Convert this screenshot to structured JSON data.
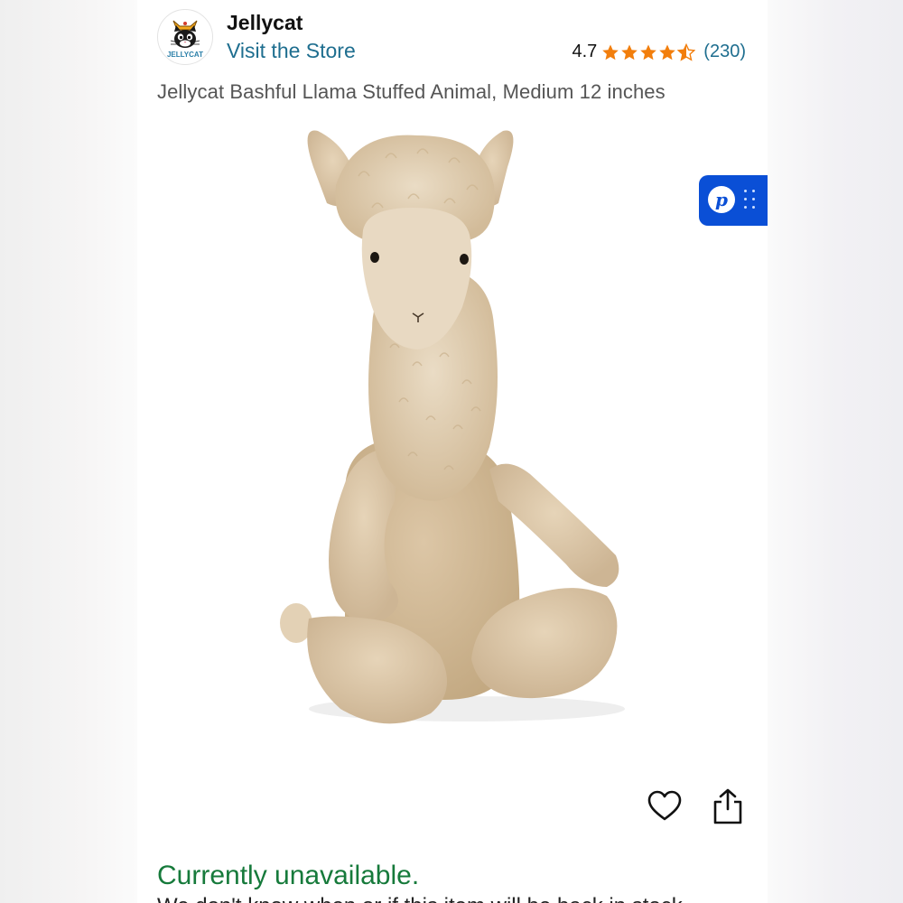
{
  "header": {
    "brand_name": "Jellycat",
    "brand_logo_text": "JELLYCAT",
    "visit_store_label": "Visit the Store",
    "rating_value": "4.7",
    "rating_stars": 4.7,
    "rating_count": "(230)"
  },
  "product": {
    "title": "Jellycat Bashful Llama Stuffed Animal, Medium 12 inches",
    "image_icon": "llama-plush-image"
  },
  "badge": {
    "letter": "p",
    "icon": "drag-handle-icon"
  },
  "actions": {
    "favorite_icon": "heart-icon",
    "share_icon": "share-icon"
  },
  "availability": {
    "status": "Currently unavailable.",
    "subtext": "We don't know when or if this item will be back in stock."
  },
  "colors": {
    "link": "#1e6e8f",
    "star": "#f27e0c",
    "available_status": "#167a3b",
    "badge": "#0a4fd6"
  }
}
